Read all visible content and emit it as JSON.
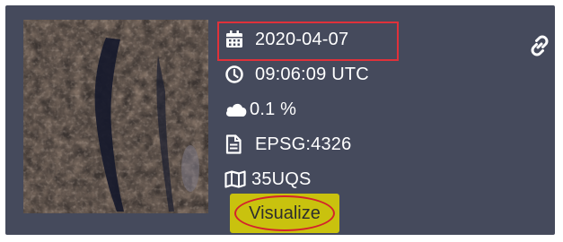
{
  "tile": {
    "date": "2020-04-07",
    "time": "09:06:09 UTC",
    "cloud_cover": "0.1 %",
    "projection": "EPSG:4326",
    "grid_tile": "35UQS",
    "visualize_label": "Visualize"
  },
  "icons": {
    "date": "calendar-icon",
    "time": "clock-icon",
    "cloud": "cloud-icon",
    "projection": "document-icon",
    "grid": "map-icon",
    "link": "link-icon"
  },
  "colors": {
    "card_background": "#454a5c",
    "highlight_red": "#e0313a",
    "visualize_button": "#c9c20e"
  }
}
